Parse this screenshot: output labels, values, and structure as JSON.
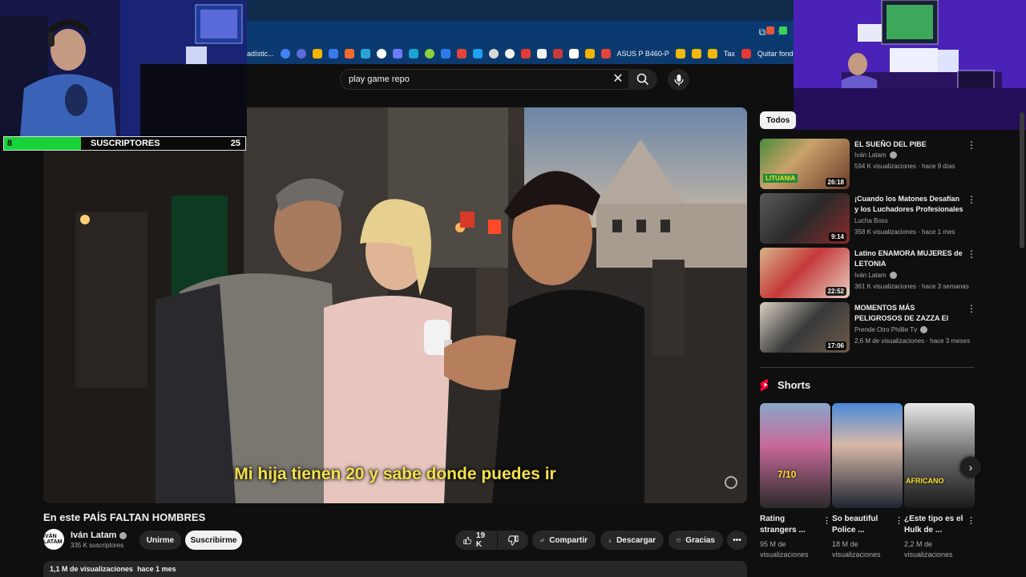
{
  "browser": {
    "bookmarks": [
      "adístic...",
      "ASUS P B460-P",
      "Tax",
      "Quitar fondo a im"
    ]
  },
  "search": {
    "query": "play game repo"
  },
  "video": {
    "subtitle": "Mi hija tienen 20 y sabe donde puedes ir",
    "title": "En este PAÍS FALTAN HOMBRES"
  },
  "stream": {
    "subs_current": "8",
    "subs_label": "SUSCRIPTORES",
    "subs_goal": "25",
    "subs_progress": 0.32
  },
  "channel": {
    "avatar_text": "IVÁN LATAM",
    "name": "Iván Latam",
    "subscribers": "335 K suscriptores",
    "join_label": "Unirme",
    "subscribe_label": "Suscribirme"
  },
  "actions": {
    "likes": "19 K",
    "share": "Compartir",
    "download": "Descargar",
    "thanks": "Gracias"
  },
  "description": {
    "views": "1,1 M de visualizaciones",
    "date": "hace 1 mes"
  },
  "sidebar": {
    "chip": "Todos",
    "recommendations": [
      {
        "title": "EL SUEÑO DEL PIBE",
        "channel": "Iván Latam",
        "meta": "594 K visualizaciones · hace 9 días",
        "duration": "26:18",
        "verified": true
      },
      {
        "title": "¡Cuando los Matones Desafían y los Luchadores Profesionales ...",
        "channel": "Lucha Boss",
        "meta": "358 K visualizaciones · hace 1 mes",
        "duration": "9:14",
        "verified": false
      },
      {
        "title": "Latino ENAMORA MUJERES de LETONIA",
        "channel": "Iván Latam",
        "meta": "361 K visualizaciones · hace 3 semanas",
        "duration": "22:52",
        "verified": true
      },
      {
        "title": "MOMENTOS MÁS PELIGROSOS DE ZAZZA El ITALIANO",
        "channel": "Prende Otro Phillie Tv",
        "meta": "2,6 M de visualizaciones · hace 3 meses",
        "duration": "17:06",
        "verified": true
      }
    ],
    "shorts_label": "Shorts",
    "shorts": [
      {
        "title": "Rating strangers ...",
        "views": "95 M de visualizaciones",
        "overlay": "7/10"
      },
      {
        "title": "So beautiful Police ...",
        "views": "18 M de visualizaciones",
        "overlay": ""
      },
      {
        "title": "¿Este tipo es el Hulk de ...",
        "views": "2,2 M de visualizaciones",
        "overlay": "AFRICANO"
      }
    ]
  }
}
